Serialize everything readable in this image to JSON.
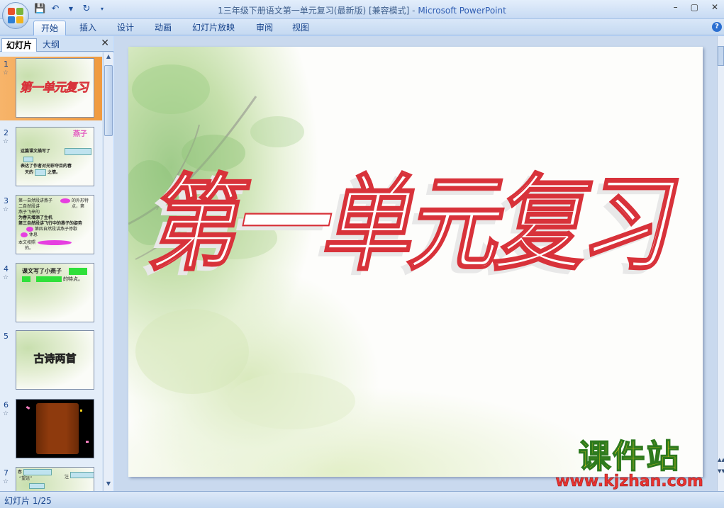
{
  "window": {
    "title": "1三年级下册语文第一单元复习(最新版) [兼容模式]",
    "title_sep": " - ",
    "app_name": "Microsoft PowerPoint",
    "controls": [
      "–",
      "▢",
      "✕"
    ]
  },
  "ribbon": {
    "tabs": [
      "开始",
      "插入",
      "设计",
      "动画",
      "幻灯片放映",
      "审阅",
      "视图"
    ],
    "active": "开始"
  },
  "panel": {
    "tabs": [
      "幻灯片",
      "大纲"
    ],
    "close": "✕"
  },
  "thumbnails": [
    {
      "num": "1",
      "text": "第一单元复习"
    },
    {
      "num": "2",
      "title": "燕子",
      "lines": [
        "这篇课文描写了",
        "表达了作者对光彩夺目的春",
        "天的",
        "之情。"
      ]
    },
    {
      "num": "3",
      "lines": [
        "第一自然段讲燕子",
        "的外形特点，第",
        "二自然段讲",
        "燕子飞来的",
        "为春天增添了生机",
        "第三自然段讲飞行中的燕子的姿势",
        "第四自然段讲燕子停歇",
        "休息",
        "本文按照",
        "的。"
      ]
    },
    {
      "num": "4",
      "lines": [
        "课文写了小燕子",
        "的特点。"
      ]
    },
    {
      "num": "5",
      "text": "古诗两首"
    },
    {
      "num": "6"
    },
    {
      "num": "7",
      "lines": [
        "春",
        "“望远”",
        "注"
      ]
    }
  ],
  "slide": {
    "title": "第一单元复习"
  },
  "statusbar": {
    "text": "幻灯片 1/25"
  },
  "watermark": {
    "cn": "课件站",
    "url": "www.kjzhan.com"
  }
}
